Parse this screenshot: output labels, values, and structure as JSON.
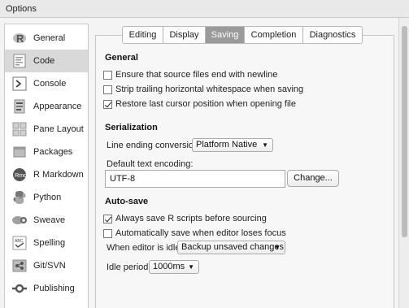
{
  "window": {
    "title": "Options"
  },
  "sidebar": {
    "items": [
      {
        "label": "General",
        "icon": "r-logo-icon"
      },
      {
        "label": "Code",
        "icon": "code-icon"
      },
      {
        "label": "Console",
        "icon": "console-icon"
      },
      {
        "label": "Appearance",
        "icon": "appearance-icon"
      },
      {
        "label": "Pane Layout",
        "icon": "pane-layout-icon"
      },
      {
        "label": "Packages",
        "icon": "packages-icon"
      },
      {
        "label": "R Markdown",
        "icon": "rmarkdown-icon"
      },
      {
        "label": "Python",
        "icon": "python-icon"
      },
      {
        "label": "Sweave",
        "icon": "sweave-icon"
      },
      {
        "label": "Spelling",
        "icon": "spelling-icon"
      },
      {
        "label": "Git/SVN",
        "icon": "git-icon"
      },
      {
        "label": "Publishing",
        "icon": "publishing-icon"
      }
    ],
    "active_index": 1
  },
  "tabs": {
    "items": [
      "Editing",
      "Display",
      "Saving",
      "Completion",
      "Diagnostics"
    ],
    "active_index": 2
  },
  "general": {
    "heading": "General",
    "opt_newline": {
      "label": "Ensure that source files end with newline",
      "checked": false
    },
    "opt_whitespace": {
      "label": "Strip trailing horizontal whitespace when saving",
      "checked": false
    },
    "opt_cursor": {
      "label": "Restore last cursor position when opening file",
      "checked": true
    }
  },
  "serialization": {
    "heading": "Serialization",
    "line_ending_label": "Line ending conversion:",
    "line_ending_value": "Platform Native",
    "encoding_label": "Default text encoding:",
    "encoding_value": "UTF-8",
    "change_button": "Change..."
  },
  "autosave": {
    "heading": "Auto-save",
    "opt_always_save": {
      "label": "Always save R scripts before sourcing",
      "checked": true
    },
    "opt_autosave_focus": {
      "label": "Automatically save when editor loses focus",
      "checked": false
    },
    "idle_label": "When editor is idle:",
    "idle_value": "Backup unsaved changes",
    "period_label": "Idle period:",
    "period_value": "1000ms"
  }
}
